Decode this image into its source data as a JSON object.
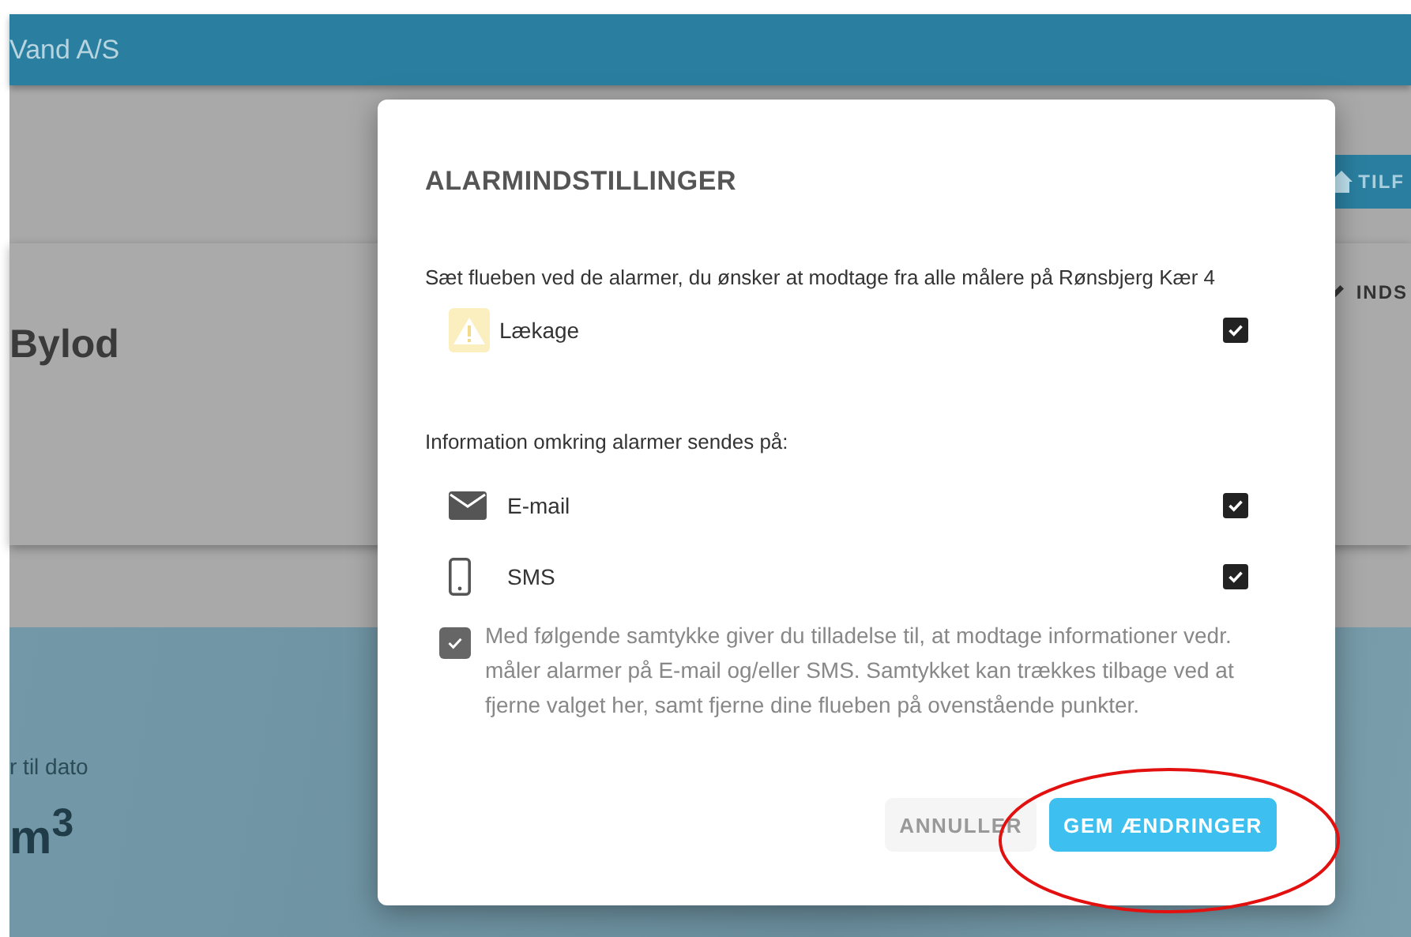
{
  "header": {
    "title": "Vand A/S"
  },
  "background": {
    "top_button": "TILF",
    "card_title": "Bylod",
    "card_action": "INDS",
    "stat_label": "r til dato",
    "stat_value": "m$^{3}$"
  },
  "dialog": {
    "title": "ALARMINDSTILLINGER",
    "intro": "Sæt flueben ved de alarmer, du ønsker at modtage fra alle målere på Rønsbjerg Kær 4",
    "alarms": [
      {
        "label": "Lækage",
        "checked": true
      }
    ],
    "channels_intro": "Information omkring alarmer sendes på:",
    "channels": [
      {
        "kind": "email",
        "label": "E-mail",
        "checked": true
      },
      {
        "kind": "sms",
        "label": "SMS",
        "checked": true
      }
    ],
    "consent": {
      "text": "Med følgende samtykke giver du tilladelse til, at modtage informationer vedr. måler alarmer på E-mail og/eller SMS. Samtykket kan trækkes tilbage ved at fjerne valget her, samt fjerne dine flueben på ovenstående punkter.",
      "checked": true
    },
    "buttons": [
      {
        "kind": "secondary",
        "label": "ANNULLER"
      },
      {
        "kind": "primary",
        "label": "GEM ÆNDRINGER"
      }
    ]
  }
}
